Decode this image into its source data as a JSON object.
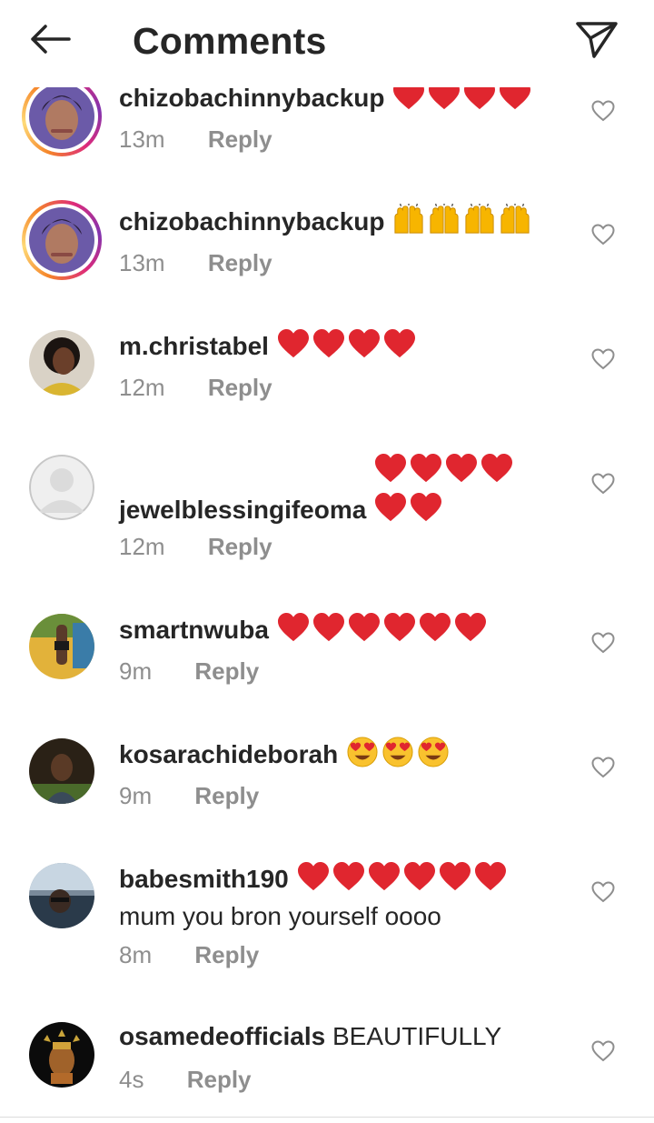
{
  "header": {
    "title": "Comments",
    "back_icon": "arrow-left-icon",
    "share_icon": "paper-plane-icon"
  },
  "colors": {
    "heart": "#ed4956",
    "meta": "#8e8e8e",
    "text": "#262626"
  },
  "comments": [
    {
      "username": "chizobachinnybackup",
      "text": "",
      "emoji": "heart",
      "emoji_count": 4,
      "time": "13m",
      "reply": "Reply",
      "avatar": "ringed-woman"
    },
    {
      "username": "chizobachinnybackup",
      "text": "",
      "emoji": "raised-hands",
      "emoji_count": 4,
      "time": "13m",
      "reply": "Reply",
      "avatar": "ringed-woman"
    },
    {
      "username": "m.christabel",
      "text": "",
      "emoji": "heart",
      "emoji_count": 4,
      "time": "12m",
      "reply": "Reply",
      "avatar": "woman-yellow"
    },
    {
      "username": "jewelblessingifeoma",
      "text": "",
      "emoji": "heart",
      "emoji_count": 6,
      "time": "12m",
      "reply": "Reply",
      "avatar": "default"
    },
    {
      "username": "smartnwuba",
      "text": "",
      "emoji": "heart",
      "emoji_count": 6,
      "time": "9m",
      "reply": "Reply",
      "avatar": "figure-yellow"
    },
    {
      "username": "kosarachideborah",
      "text": "",
      "emoji": "heart-eyes",
      "emoji_count": 3,
      "time": "9m",
      "reply": "Reply",
      "avatar": "dark-portrait"
    },
    {
      "username": "babesmith190",
      "text": "mum you bron yourself oooo",
      "emoji": "heart",
      "emoji_count": 6,
      "time": "8m",
      "reply": "Reply",
      "avatar": "man-car"
    },
    {
      "username": "osamedeofficials",
      "text": "BEAUTIFULLY",
      "emoji": "",
      "emoji_count": 0,
      "time": "4s",
      "reply": "Reply",
      "avatar": "bronze-head"
    }
  ]
}
